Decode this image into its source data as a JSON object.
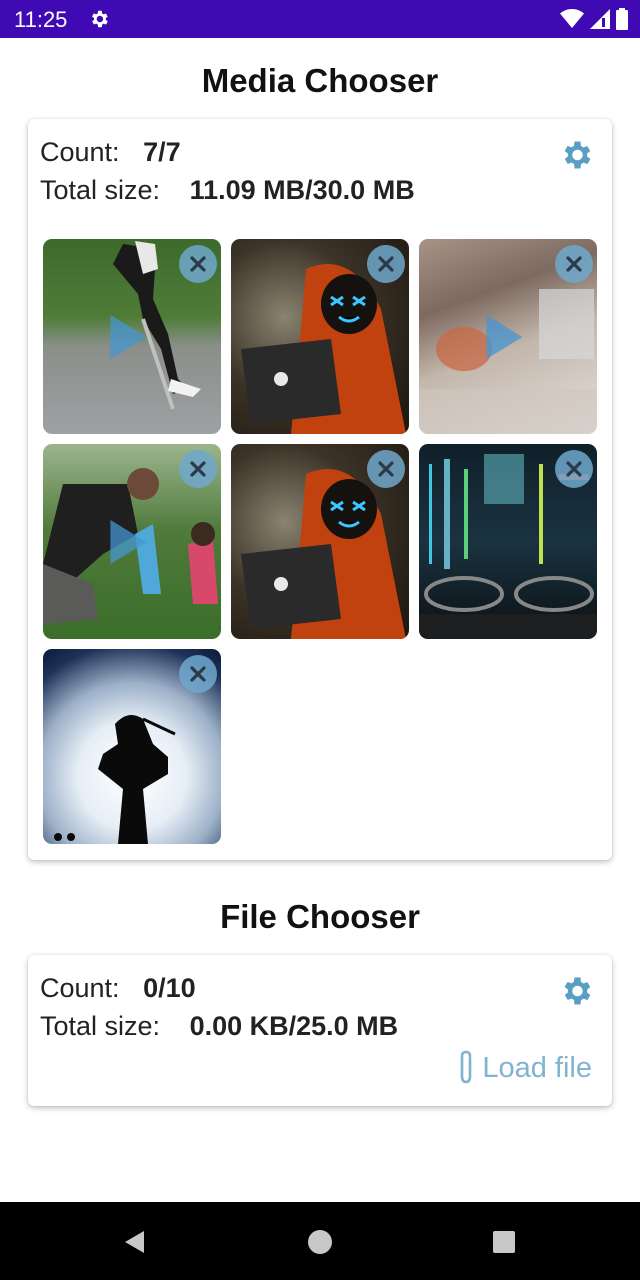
{
  "status_bar": {
    "time": "11:25",
    "icons": [
      "settings-icon",
      "wifi-icon",
      "signal-icon",
      "battery-icon"
    ]
  },
  "media_chooser": {
    "title": "Media Chooser",
    "count_label": "Count:",
    "count_value": "7/7",
    "size_label": "Total size:",
    "size_value": "11.09 MB/30.0 MB",
    "thumbnails": [
      {
        "kind": "video",
        "subject": "skater kid on road"
      },
      {
        "kind": "image",
        "subject": "hooded hacker with laptop"
      },
      {
        "kind": "video",
        "subject": "blurry indoor motion"
      },
      {
        "kind": "video",
        "subject": "family playing in yard"
      },
      {
        "kind": "image",
        "subject": "hooded hacker with laptop"
      },
      {
        "kind": "image",
        "subject": "code monitor with glasses"
      },
      {
        "kind": "image",
        "subject": "silhouette against moon"
      }
    ]
  },
  "file_chooser": {
    "title": "File Chooser",
    "count_label": "Count:",
    "count_value": "0/10",
    "size_label": "Total size:",
    "size_value": "0.00 KB/25.0 MB",
    "load_file_label": "Load file"
  },
  "colors": {
    "status_bar": "#3f0ab4",
    "accent": "#5a9ec4",
    "close_button": "#70a8cd",
    "load_file": "#7fb3d0"
  }
}
